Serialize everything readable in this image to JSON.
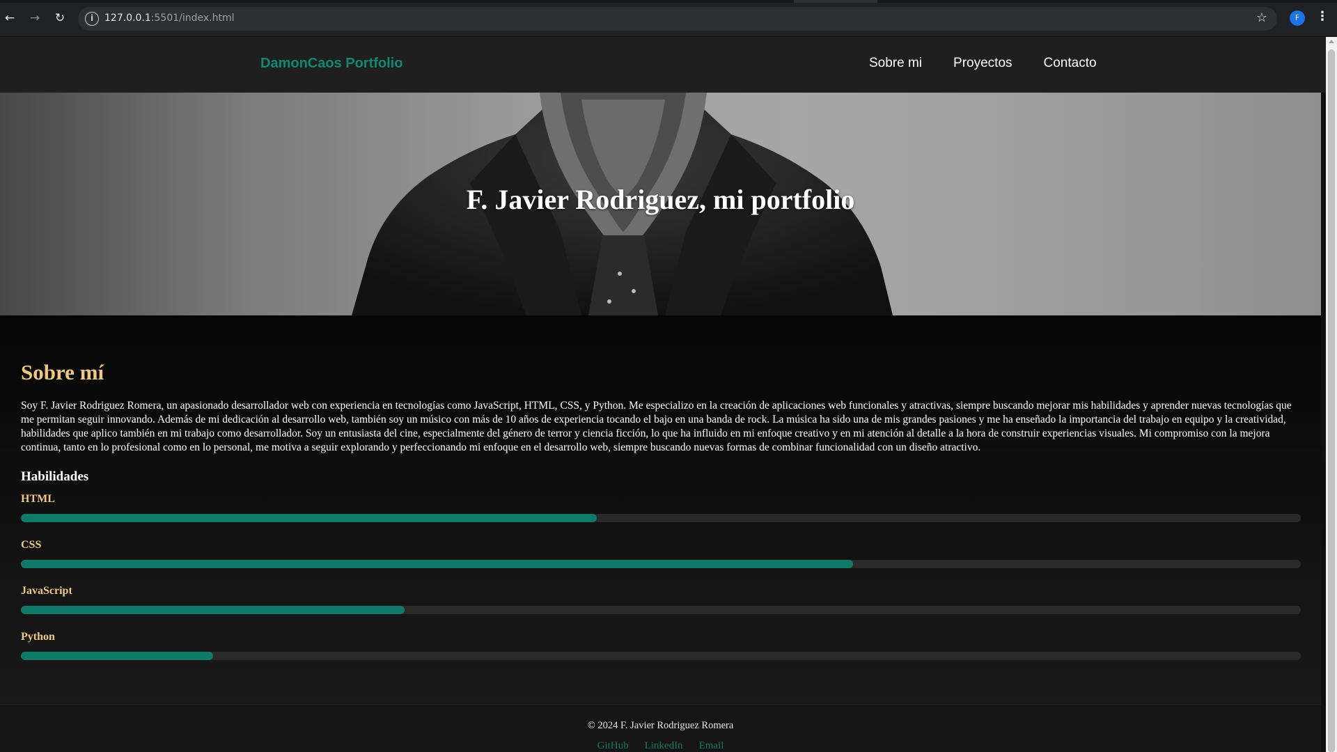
{
  "browser": {
    "url_host": "127.0.0.1",
    "url_rest": ":5501/index.html",
    "profile_initial": "F",
    "icons": [
      "back-arrow-icon",
      "forward-arrow-icon",
      "reload-icon",
      "site-info-icon",
      "bookmark-star-icon",
      "kebab-menu-icon"
    ]
  },
  "header": {
    "brand": "DamonCaos Portfolio",
    "nav": [
      "Sobre mi",
      "Proyectos",
      "Contacto"
    ]
  },
  "hero": {
    "title": "F. Javier Rodriguez, mi portfolio"
  },
  "about": {
    "heading": "Sobre mí",
    "bio": "Soy F. Javier Rodriguez Romera, un apasionado desarrollador web con experiencia en tecnologías como JavaScript, HTML, CSS, y Python. Me especializo en la creación de aplicaciones web funcionales y atractivas, siempre buscando mejorar mis habilidades y aprender nuevas tecnologías que me permitan seguir innovando. Además de mi dedicación al desarrollo web, también soy un músico con más de 10 años de experiencia tocando el bajo en una banda de rock. La música ha sido una de mis grandes pasiones y me ha enseñado la importancia del trabajo en equipo y la creatividad, habilidades que aplico también en mi trabajo como desarrollador. Soy un entusiasta del cine, especialmente del género de terror y ciencia ficción, lo que ha influido en mi enfoque creativo y en mi atención al detalle a la hora de construir experiencias visuales. Mi compromiso con la mejora continua, tanto en lo profesional como en lo personal, me motiva a seguir explorando y perfeccionando mi enfoque en el desarrollo web, siempre buscando nuevas formas de combinar funcionalidad con un diseño atractivo.",
    "skills_heading": "Habilidades",
    "skills": [
      {
        "name": "HTML",
        "level_percent": 45
      },
      {
        "name": "CSS",
        "level_percent": 65
      },
      {
        "name": "JavaScript",
        "level_percent": 30
      },
      {
        "name": "Python",
        "level_percent": 15
      }
    ]
  },
  "footer": {
    "copyright": "© 2024 F. Javier Rodriguez Romera",
    "links": [
      "GitHub",
      "LinkedIn",
      "Email"
    ]
  },
  "colors": {
    "brand_accent": "#0e8a72",
    "skill_fill": "#0e7a68",
    "heading_gold": "#f0c87a",
    "page_background": "#0f0f0f"
  }
}
